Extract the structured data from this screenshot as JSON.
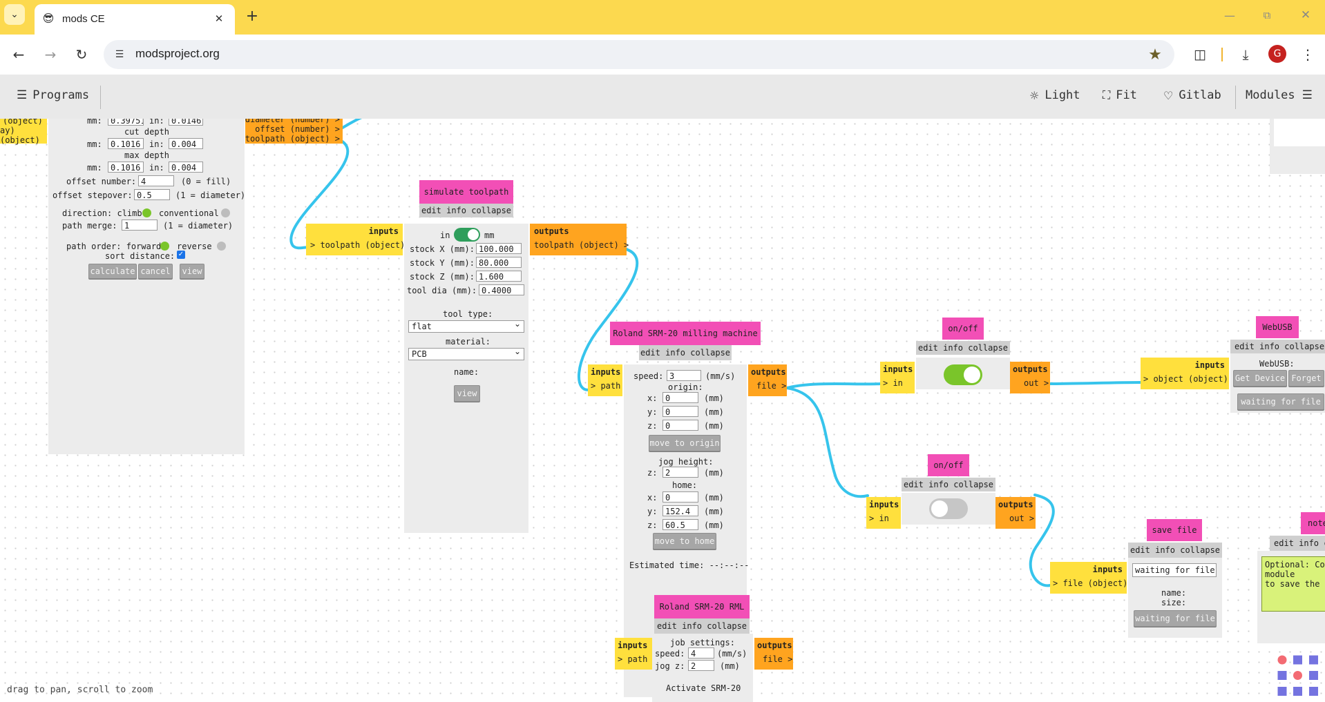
{
  "browser": {
    "tab_title": "mods CE",
    "new_tab_glyph": "+",
    "url": "modsproject.org",
    "profile_initial": "G",
    "icons": [
      "tab-search-icon",
      "emoji-sunglasses-icon",
      "close-icon",
      "new-tab-icon",
      "minimize-icon",
      "restore-icon",
      "window-close-icon",
      "back-icon",
      "forward-icon",
      "reload-icon",
      "site-info-icon",
      "bookmark-star-icon",
      "extensions-icon",
      "download-icon",
      "menu-dots-icon"
    ]
  },
  "appbar": {
    "programs": "Programs",
    "light": "Light",
    "fit": "Fit",
    "gitlab": "Gitlab",
    "modules": "Modules"
  },
  "left_stub": {
    "line1": "(object)",
    "line2": "ay)",
    "line3": "(object)"
  },
  "mill_settings": {
    "top_row": {
      "mm": "mm:",
      "mm_val": "0.39751",
      "in": "in:",
      "in_val": "0.01461"
    },
    "cut_depth": "cut depth",
    "cut_mm_label": "mm:",
    "cut_mm": "0.1016",
    "cut_in_label": "in:",
    "cut_in": "0.004",
    "max_depth": "max depth",
    "max_mm_label": "mm:",
    "max_mm": "0.1016",
    "max_in_label": "in:",
    "max_in": "0.004",
    "offset_number_label": "offset number:",
    "offset_number": "4",
    "offset_number_hint": "(0 = fill)",
    "offset_stepover_label": "offset stepover:",
    "offset_stepover": "0.5",
    "offset_stepover_hint": "(1 = diameter)",
    "direction_label": "direction: climb",
    "conventional": "conventional",
    "path_merge_label": "path merge:",
    "path_merge": "1",
    "path_merge_hint": "(1 = diameter)",
    "path_order_label": "path order: forward",
    "reverse": "reverse",
    "sort_distance": "sort distance:",
    "calculate": "calculate",
    "cancel": "cancel",
    "view": "view"
  },
  "mill_outputs": [
    "diameter (number) >",
    "offset (number) >",
    "toolpath (object) >"
  ],
  "simulate": {
    "title": "simulate toolpath",
    "menu": "edit info collapse",
    "inputs": "inputs",
    "input_port": "> toolpath (object)",
    "outputs": "outputs",
    "output_port": "toolpath (object) >",
    "unit_in": "in",
    "unit_mm": "mm",
    "stock_x_label": "stock X (mm):",
    "stock_x": "100.000",
    "stock_y_label": "stock Y (mm):",
    "stock_y": "80.000",
    "stock_z_label": "stock Z (mm):",
    "stock_z": "1.600",
    "tool_dia_label": "tool dia (mm):",
    "tool_dia": "0.4000",
    "tool_type_label": "tool type:",
    "tool_type": "flat",
    "material_label": "material:",
    "material": "PCB",
    "name_label": "name:",
    "view": "view"
  },
  "roland": {
    "title": "Roland SRM-20 milling machine",
    "menu": "edit info collapse",
    "inputs": "inputs",
    "input_port": "> path",
    "outputs": "outputs",
    "output_port": "file >",
    "speed_label": "speed:",
    "speed": "3",
    "speed_unit": "(mm/s)",
    "origin": "origin:",
    "ox": "0",
    "oy": "0",
    "oz": "0",
    "x": "x:",
    "y": "y:",
    "z": "z:",
    "mm": "(mm)",
    "move_origin": "move to origin",
    "jog_height": "jog height:",
    "jz": "2",
    "home": "home:",
    "hx": "0",
    "hy": "152.4",
    "hz": "60.5",
    "move_home": "move to home",
    "estimated": "Estimated time: --:--:--"
  },
  "onoff1": {
    "title": "on/off",
    "menu": "edit info collapse",
    "inputs": "inputs",
    "input_port": "> in",
    "outputs": "outputs",
    "output_port": "out >",
    "state": 1
  },
  "onoff2": {
    "title": "on/off",
    "menu": "edit info collapse",
    "inputs": "inputs",
    "input_port": "> in",
    "outputs": "outputs",
    "output_port": "out >",
    "state": 0
  },
  "webusb": {
    "title": "WebUSB",
    "menu": "edit info collapse",
    "inputs": "inputs",
    "input_port": "> object (object)",
    "label": "WebUSB:",
    "get_device": "Get Device",
    "forget": "Forget",
    "waiting": "waiting for file"
  },
  "savefile": {
    "title": "save file",
    "menu": "edit info collapse",
    "inputs": "inputs",
    "input_port": "> file (object)",
    "waiting_box": "waiting for file",
    "name": "name:",
    "size": "size:",
    "waiting_btn": "waiting for file"
  },
  "note": {
    "title": "note",
    "menu": "edit info c",
    "text1": "Optional: Con",
    "text2": "module",
    "text3": "to save the t"
  },
  "rml": {
    "title": "Roland SRM-20 RML",
    "menu": "edit info collapse",
    "inputs": "inputs",
    "input_port": "> path",
    "outputs": "outputs",
    "output_port": "file >",
    "job_settings": "job settings:",
    "speed_label": "speed:",
    "speed": "4",
    "speed_unit": "(mm/s)",
    "jogz_label": "jog z:",
    "jogz": "2",
    "jogz_unit": "(mm)",
    "activate": "Activate SRM-20"
  },
  "status": "drag to pan, scroll to zoom",
  "colors": {
    "module_title": "#f24fb6",
    "inputs": "#ffe03d",
    "outputs": "#ffa41f",
    "wire": "#36c4ec",
    "toggle_on": "#7ac52a",
    "tab_bar": "#fcd94f"
  }
}
